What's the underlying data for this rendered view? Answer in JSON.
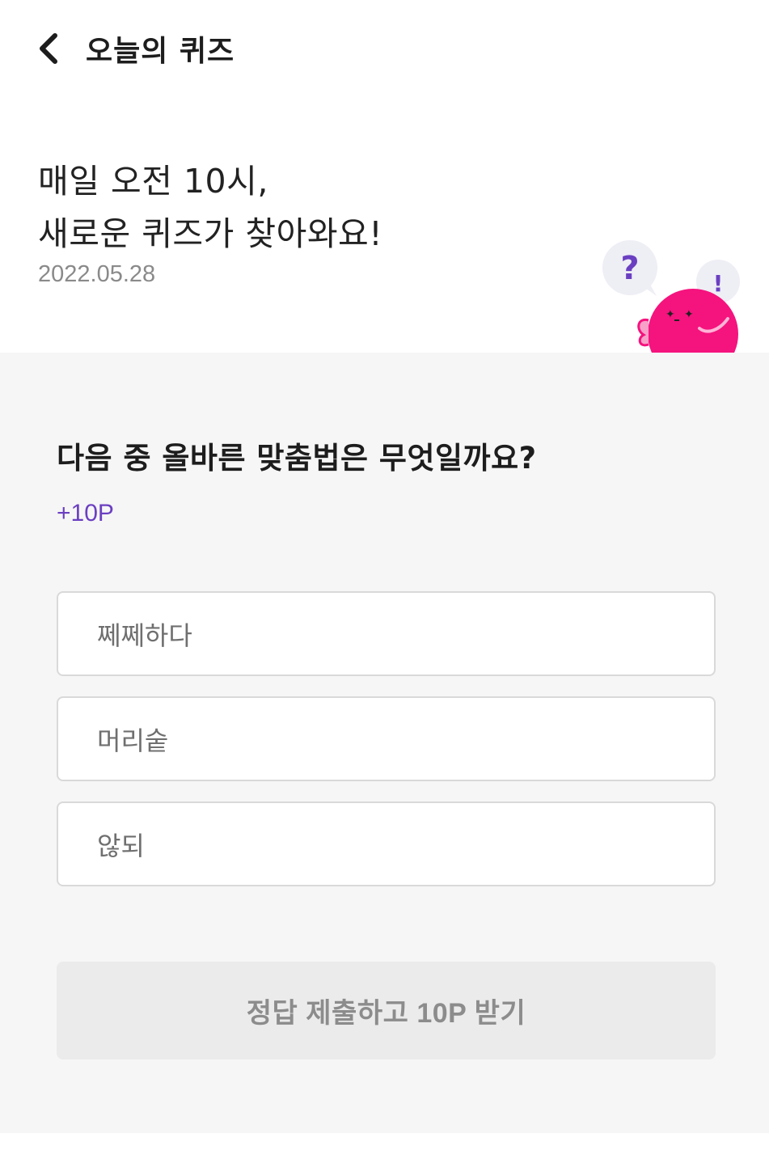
{
  "header": {
    "title": "오늘의 퀴즈",
    "back_icon": "chevron-left-icon"
  },
  "hero": {
    "line1": "매일 오전 10시,",
    "line2": "새로운 퀴즈가 찾아와요!",
    "date": "2022.05.28",
    "bubble_question": "?",
    "bubble_exclaim": "!"
  },
  "quiz": {
    "question": "다음 중 올바른 맞춤법은 무엇일까요?",
    "points": "+10P",
    "options": [
      {
        "label": "쩨쩨하다"
      },
      {
        "label": "머리숱"
      },
      {
        "label": "않되"
      }
    ],
    "submit_label": "정답 제출하고 10P 받기"
  },
  "colors": {
    "accent": "#6b3fc1",
    "mascot": "#f5137e",
    "panel_bg": "#f6f6f6",
    "button_bg": "#ebebeb"
  }
}
